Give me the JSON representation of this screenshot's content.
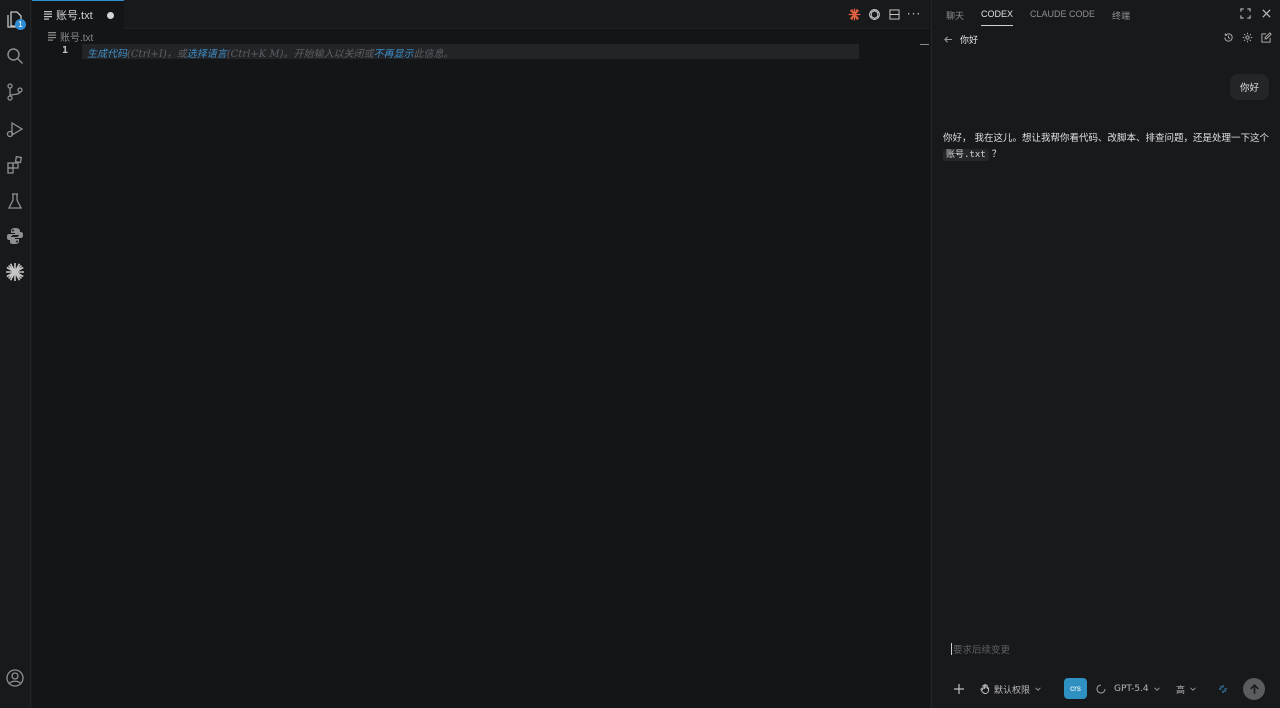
{
  "activity_bar": {
    "explorer_badge": "1",
    "icons": [
      "files-icon",
      "search-icon",
      "source-control-icon",
      "run-debug-icon",
      "extensions-icon",
      "testing-flask-icon",
      "python-icon",
      "claude-starburst-icon",
      "account-icon"
    ]
  },
  "editor": {
    "tab": {
      "label": "账号.txt",
      "dirty": true
    },
    "breadcrumb": "账号.txt",
    "line_number": "1",
    "hint": {
      "part1": "生成代码",
      "part2": "(Ctrl+I)，或",
      "part3": "选择语言",
      "part4": "(Ctrl+K M)。开始输入以关闭或",
      "part5": "不再显示",
      "part6": "此信息。"
    },
    "more_actions": "···"
  },
  "panel": {
    "tabs": [
      "聊天",
      "CODEX",
      "CLAUDE CODE",
      "终端"
    ],
    "active_tab": "CODEX",
    "chat_title": "你好",
    "user_message": "你好",
    "assistant_message": {
      "text": "你好， 我在这儿。想让我帮你看代码、改脚本、排查问题，还是处理一下这个",
      "code": "账号.txt",
      "tail": "？"
    },
    "composer": {
      "placeholder": "要求后续变更",
      "permission_label": "默认权限",
      "profile_chip": "crs",
      "model_label": "GPT-5.4",
      "effort_label": "高"
    }
  },
  "colors": {
    "accent_blue": "#2f8dd6",
    "editor_bg": "#141517",
    "sidebar_bg": "#18191b",
    "claude_orange": "#e2603f"
  }
}
